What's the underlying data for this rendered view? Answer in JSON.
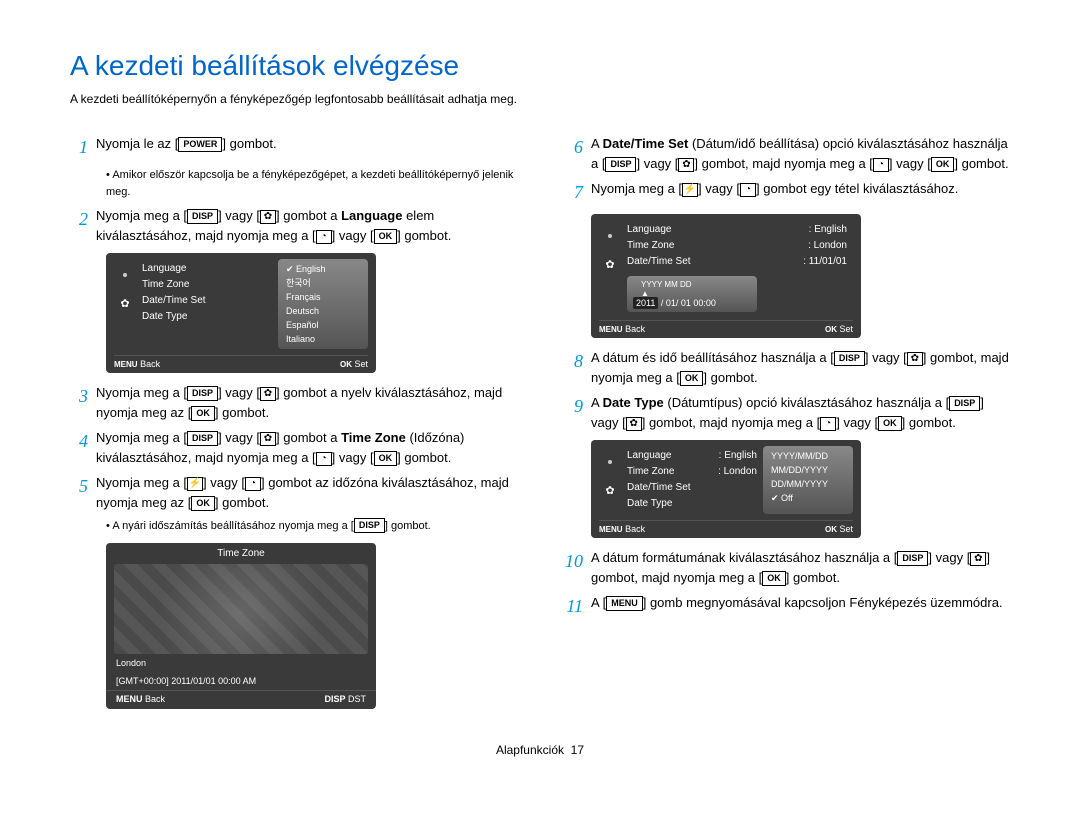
{
  "title": "A kezdeti beállítások elvégzése",
  "subtitle": "A kezdeti beállítóképernyőn a fényképezőgép legfontosabb beállításait adhatja meg.",
  "buttons": {
    "power": "POWER",
    "disp": "DISP",
    "ok": "OK",
    "menu": "MENU"
  },
  "left": {
    "s1": "Nyomja le az ",
    "s1b": " gombot.",
    "s1_bullet": "Amikor először kapcsolja be a fényképezőgépet, a kezdeti beállítóképernyő jelenik meg.",
    "s2a": "Nyomja meg a ",
    "s2b": " vagy ",
    "s2c": " gombot a ",
    "s2d": "Language",
    "s2e": " elem kiválasztásához, majd nyomja meg a ",
    "s2f": " vagy ",
    "s2g": " gombot.",
    "s3a": "Nyomja meg a ",
    "s3b": " vagy ",
    "s3c": " gombot a nyelv kiválasztásához, majd nyomja meg az ",
    "s3d": " gombot.",
    "s4a": "Nyomja meg a ",
    "s4b": " vagy ",
    "s4c": " gombot a ",
    "s4d": "Time Zone",
    "s4e": " (Időzóna) kiválasztásához, majd nyomja meg a ",
    "s4f": " vagy ",
    "s4g": " gombot.",
    "s5a": "Nyomja meg a ",
    "s5b": " vagy ",
    "s5c": " gombot az időzóna kiválasztásához, majd nyomja meg az ",
    "s5d": " gombot.",
    "s5_bullet": "A nyári időszámítás beállításához nyomja meg a ",
    "s5_bullet_end": " gombot."
  },
  "lcd1": {
    "items": [
      "Language",
      "Time Zone",
      "Date/Time Set",
      "Date Type"
    ],
    "opts": [
      "English",
      "한국어",
      "Français",
      "Deutsch",
      "Español",
      "Italiano"
    ],
    "back": "Back",
    "set": "Set"
  },
  "tz": {
    "title": "Time Zone",
    "city": "London",
    "gmt": "[GMT+00:00]   2011/01/01   00:00 AM",
    "back": "Back",
    "dst": "DST"
  },
  "right": {
    "s6a": "A ",
    "s6b": "Date/Time Set",
    "s6c": " (Dátum/idő beállítása) opció kiválasztásához használja a ",
    "s6d": " vagy ",
    "s6e": " gombot, majd nyomja meg a ",
    "s6f": " vagy ",
    "s6g": " gombot.",
    "s7a": "Nyomja meg a ",
    "s7b": " vagy ",
    "s7c": " gombot egy tétel kiválasztásához.",
    "s8a": "A dátum és idő beállításához használja a ",
    "s8b": " vagy ",
    "s8c": " gombot, majd nyomja meg a ",
    "s8d": " gombot.",
    "s9a": "A ",
    "s9b": "Date Type",
    "s9c": " (Dátumtípus) opció kiválasztásához használja a ",
    "s9d": " vagy ",
    "s9e": " gombot, majd nyomja meg a ",
    "s9f": " vagy ",
    "s9g": " gombot.",
    "s10a": "A dátum formátumának kiválasztásához használja a ",
    "s10b": " vagy ",
    "s10c": " gombot, majd nyomja meg a ",
    "s10d": " gombot.",
    "s11a": "A ",
    "s11b": " gomb megnyomásával kapcsoljon Fényképezés üzemmódra."
  },
  "lcd2": {
    "lang_l": "Language",
    "lang_v": ": English",
    "tz_l": "Time Zone",
    "tz_v": ": London",
    "dt_l": "Date/Time Set",
    "dt_v": ": 11/01/01",
    "caret_label": "YYYY MM DD",
    "date_value_hl": "2011",
    "date_value_rest": "/ 01/ 01  00:00",
    "back": "Back",
    "set": "Set"
  },
  "lcd3": {
    "lang_l": "Language",
    "lang_v": ": English",
    "tz_l": "Time Zone",
    "tz_v": ": London",
    "dt_l": "Date/Time Set",
    "dtype_l": "Date Type",
    "opts": [
      "YYYY/MM/DD",
      "MM/DD/YYYY",
      "DD/MM/YYYY",
      "Off"
    ],
    "back": "Back",
    "set": "Set"
  },
  "footer": {
    "label": "Alapfunkciók",
    "page": "17"
  }
}
